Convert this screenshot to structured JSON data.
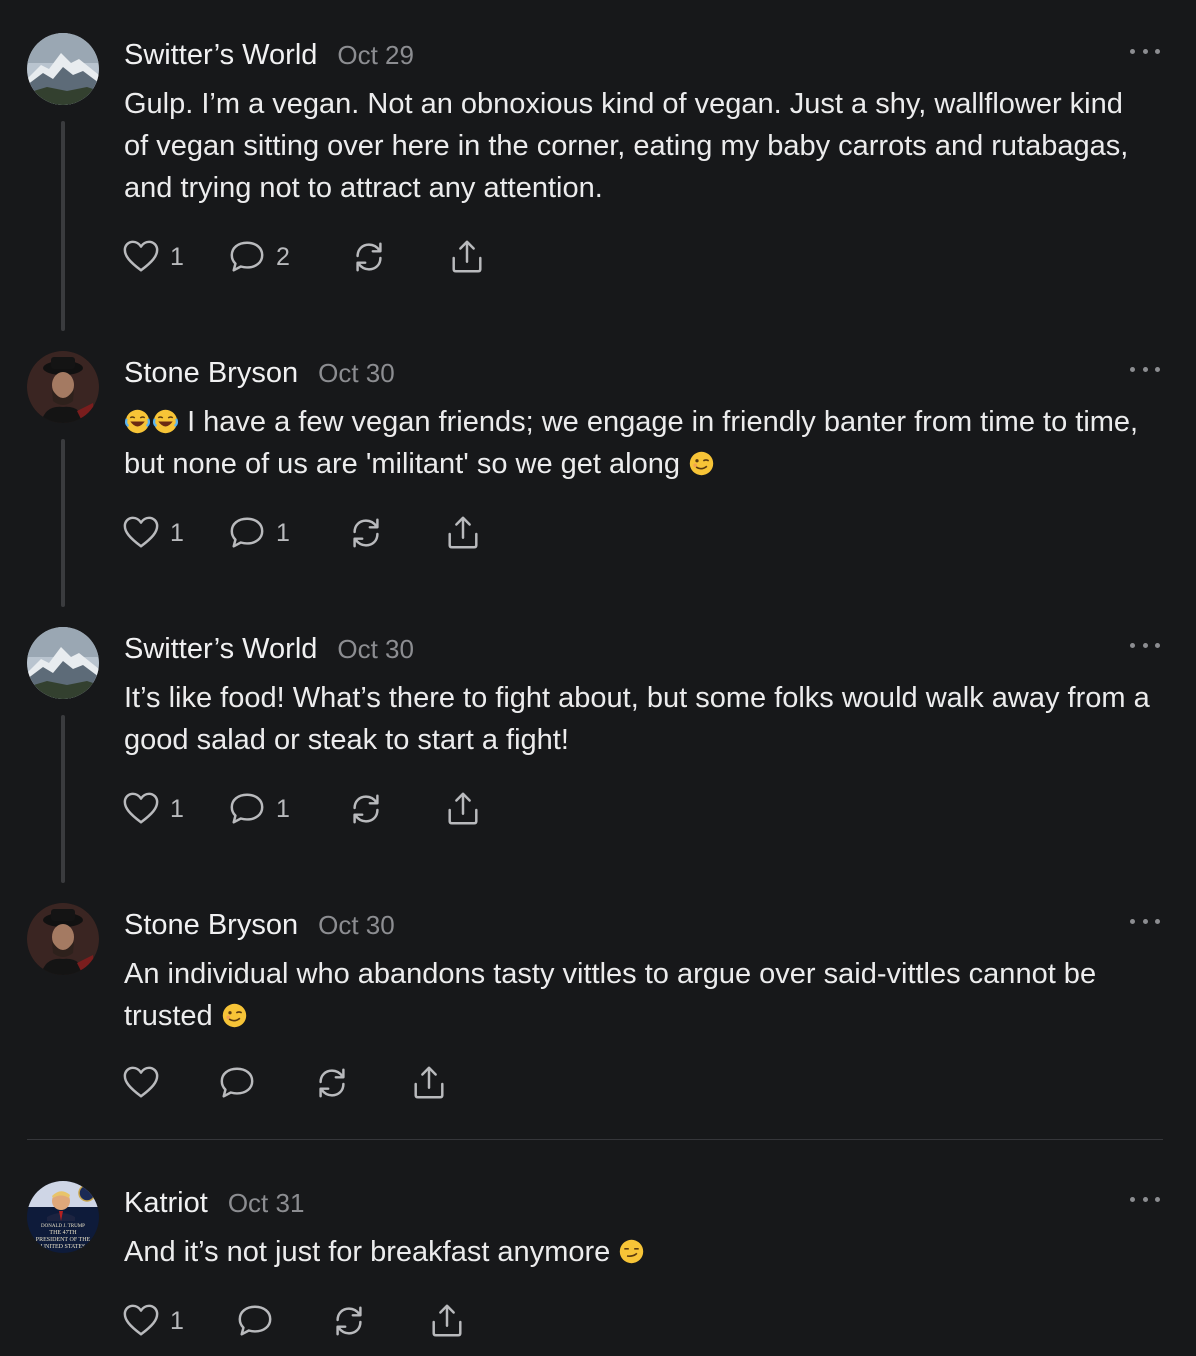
{
  "posts": [
    {
      "author": "Switter’s World",
      "date": "Oct 29",
      "text": "Gulp. I’m a vegan. Not an obnoxious kind of vegan. Just a shy, wallflower kind of vegan sitting over here in the corner, eating my baby carrots and rutabagas, and trying not to attract any attention.",
      "likes": "1",
      "replies": "2",
      "avatar_icon": "mountain-avatar"
    },
    {
      "author": "Stone Bryson",
      "date": "Oct 30",
      "text_pre": "😂😂",
      "text": "I have a few vegan friends; we engage in friendly banter from time to time, but none of us are 'militant' so we get along",
      "text_post": "😉",
      "likes": "1",
      "replies": "1",
      "avatar_icon": "man-in-hat-avatar"
    },
    {
      "author": "Switter’s World",
      "date": "Oct 30",
      "text": "It’s like food! What’s there to fight about, but some folks would walk away from a good salad or steak to start a fight!",
      "likes": "1",
      "replies": "1",
      "avatar_icon": "mountain-avatar"
    },
    {
      "author": "Stone Bryson",
      "date": "Oct 30",
      "text": "An individual who abandons tasty vittles to argue over said-vittles cannot be trusted",
      "text_post": "😉",
      "likes": "",
      "replies": "",
      "avatar_icon": "man-in-hat-avatar"
    },
    {
      "author": "Katriot",
      "date": "Oct 31",
      "text": "And it’s not just for breakfast anymore",
      "text_post": "😏",
      "likes": "1",
      "replies": "",
      "avatar_icon": "portrait-avatar",
      "avatar_text": [
        "DONALD J. TRUMP",
        "THE 47TH",
        "PRESIDENT OF THE",
        "UNITED STATES"
      ]
    }
  ],
  "colors": {
    "background": "#17181a",
    "text": "#ececed",
    "muted": "#8c8d91",
    "thread_line": "#3a3b3e"
  }
}
